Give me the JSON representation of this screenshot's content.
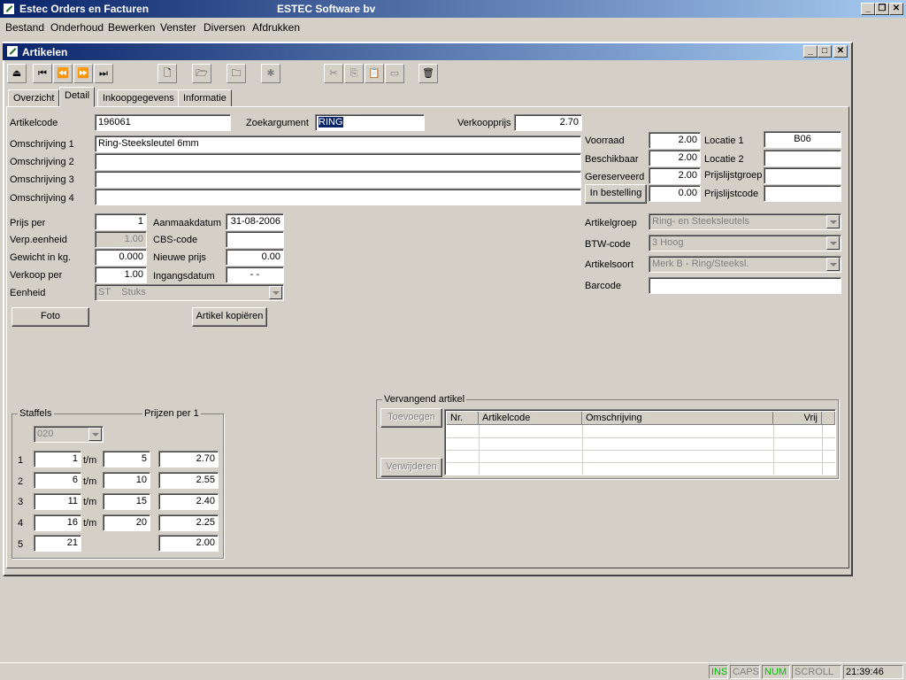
{
  "app": {
    "title": "Estec Orders en Facturen",
    "company": "ESTEC Software bv"
  },
  "menu": [
    "Bestand",
    "Onderhoud",
    "Bewerken",
    "Venster",
    "Diversen",
    "Afdrukken"
  ],
  "window": {
    "title": "Artikelen"
  },
  "tabs": [
    "Overzicht",
    "Detail",
    "Inkoopgegevens",
    "Informatie"
  ],
  "form": {
    "artikelcode_label": "Artikelcode",
    "artikelcode": "196061",
    "zoekargument_label": "Zoekargument",
    "zoekargument": "RING",
    "verkoopprijs_label": "Verkoopprijs",
    "verkoopprijs": "2.70",
    "omschrijving1_label": "Omschrijving 1",
    "omschrijving1": "Ring-Steeksleutel 6mm",
    "omschrijving2_label": "Omschrijving 2",
    "omschrijving2": "",
    "omschrijving3_label": "Omschrijving 3",
    "omschrijving3": "",
    "omschrijving4_label": "Omschrijving 4",
    "omschrijving4": "",
    "voorraad_label": "Voorraad",
    "voorraad": "2.00",
    "beschikbaar_label": "Beschikbaar",
    "beschikbaar": "2.00",
    "gereserveerd_label": "Gereserveerd",
    "gereserveerd": "2.00",
    "in_bestelling_label": "In bestelling",
    "in_bestelling": "0.00",
    "locatie1_label": "Locatie 1",
    "locatie1": "B06",
    "locatie2_label": "Locatie 2",
    "locatie2": "",
    "prijslijstgroep_label": "Prijslijstgroep",
    "prijslijstgroep": "",
    "prijslijstcode_label": "Prijslijstcode",
    "prijslijstcode": "",
    "prijs_per_label": "Prijs per",
    "prijs_per": "1",
    "verp_eenheid_label": "Verp.eenheid",
    "verp_eenheid": "1.00",
    "gewicht_label": "Gewicht in kg.",
    "gewicht": "0.000",
    "verkoop_per_label": "Verkoop per",
    "verkoop_per": "1.00",
    "eenheid_label": "Eenheid",
    "eenheid_code": "ST",
    "eenheid": "Stuks",
    "aanmaakdatum_label": "Aanmaakdatum",
    "aanmaakdatum": "31-08-2006",
    "cbs_code_label": "CBS-code",
    "cbs_code": "",
    "nieuwe_prijs_label": "Nieuwe prijs",
    "nieuwe_prijs": "0.00",
    "ingangsdatum_label": "Ingangsdatum",
    "ingangsdatum": "-   -",
    "artikelgroep_label": "Artikelgroep",
    "artikelgroep": "Ring- en Steeksleutels",
    "btw_code_label": "BTW-code",
    "btw_code": "3 Hoog",
    "artikelsoort_label": "Artikelsoort",
    "artikelsoort": "Merk B - Ring/Steeksl.",
    "barcode_label": "Barcode",
    "barcode": ""
  },
  "buttons": {
    "foto": "Foto",
    "artikel_kopieren": "Artikel kopiëren",
    "toevoegen": "Toevoegen",
    "verwijderen": "Verwijderen"
  },
  "staffels": {
    "title": "Staffels",
    "prices_title": "Prijzen per 1",
    "code": "020",
    "tm": "t/m",
    "rows": [
      {
        "nr": "1",
        "from": "1",
        "to": "5",
        "price": "2.70"
      },
      {
        "nr": "2",
        "from": "6",
        "to": "10",
        "price": "2.55"
      },
      {
        "nr": "3",
        "from": "11",
        "to": "15",
        "price": "2.40"
      },
      {
        "nr": "4",
        "from": "16",
        "to": "20",
        "price": "2.25"
      },
      {
        "nr": "5",
        "from": "21",
        "to": "",
        "price": "2.00"
      }
    ]
  },
  "vervangend": {
    "title": "Vervangend artikel",
    "columns": [
      "Nr.",
      "Artikelcode",
      "Omschrijving",
      "Vrij"
    ]
  },
  "status": {
    "ins": "INS",
    "caps": "CAPS",
    "num": "NUM",
    "scroll": "SCROLL",
    "time": "21:39:46"
  },
  "colors": {
    "titlebar": "#0a246a",
    "face": "#d4d0c8",
    "status_on": "#00c000"
  }
}
